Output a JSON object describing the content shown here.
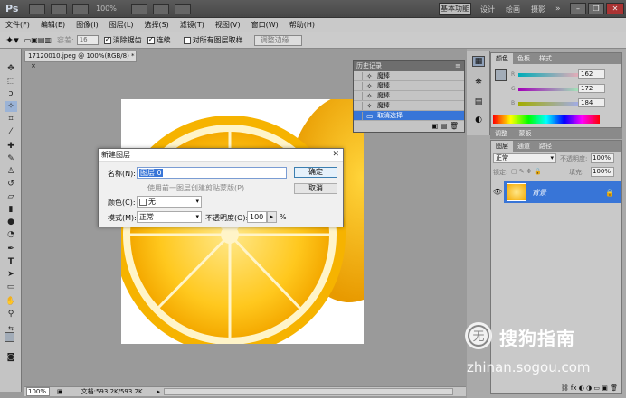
{
  "titlebar": {
    "app_logo": "Ps",
    "zoom": "100%",
    "basic_label": "基本功能",
    "ws1": "设计",
    "ws2": "绘画",
    "ws3": "摄影"
  },
  "menu": [
    "文件(F)",
    "编辑(E)",
    "图像(I)",
    "图层(L)",
    "选择(S)",
    "滤镜(T)",
    "视图(V)",
    "窗口(W)",
    "帮助(H)"
  ],
  "options": {
    "tolerance_label": "容差:",
    "tolerance_value": "16",
    "antialias": "消除锯齿",
    "contiguous": "连续",
    "sample_all": "对所有图层取样",
    "refine_edge": "调整边缘..."
  },
  "document": {
    "tab_title": "17120010.jpeg @ 100%(RGB/8) *",
    "zoom": "100%",
    "doc_size": "文档:593.2K/593.2K"
  },
  "history": {
    "title": "历史记录",
    "items": [
      {
        "label": "魔棒"
      },
      {
        "label": "魔棒"
      },
      {
        "label": "魔棒"
      },
      {
        "label": "魔棒"
      },
      {
        "label": "取消选择"
      }
    ]
  },
  "color_panel": {
    "tabs": [
      "颜色",
      "色板",
      "样式"
    ],
    "r_label": "R",
    "g_label": "G",
    "b_label": "B",
    "r": "162",
    "g": "172",
    "b": "184"
  },
  "adjust_panel": {
    "tabs": [
      "调整",
      "蒙板"
    ]
  },
  "layers_panel": {
    "tabs": [
      "图层",
      "通道",
      "路径"
    ],
    "blend_mode": "正常",
    "opacity_label": "不透明度:",
    "opacity": "100%",
    "lock_label": "锁定:",
    "fill_label": "填充:",
    "fill": "100%",
    "layer_name": "背景"
  },
  "dialog": {
    "title": "新建图层",
    "name_label": "名称(N):",
    "name_value": "图层 0",
    "clip_label": "使用前一图层创建剪贴蒙版(P)",
    "color_label": "颜色(C):",
    "color_value": "无",
    "mode_label": "模式(M):",
    "mode_value": "正常",
    "opacity_label": "不透明度(O):",
    "opacity_value": "100",
    "percent": "%",
    "ok": "确定",
    "cancel": "取消"
  },
  "watermark": {
    "brand": "搜狗指南",
    "url": "zhinan.sogou.com"
  }
}
